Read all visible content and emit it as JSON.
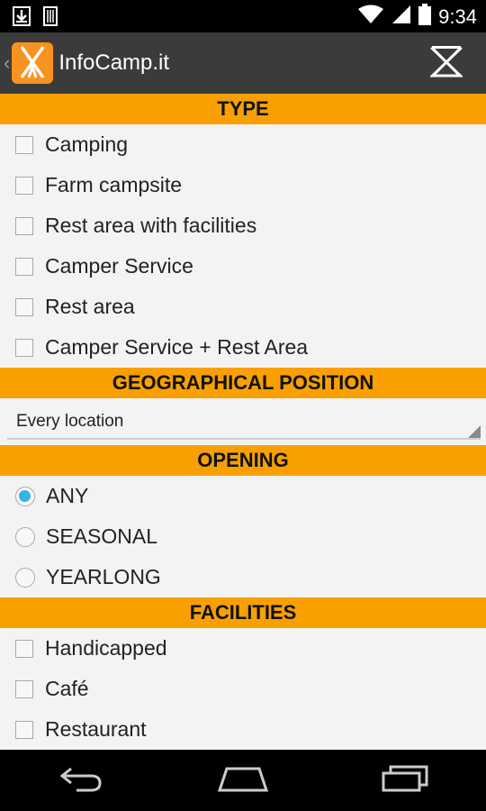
{
  "status_bar": {
    "time": "9:34"
  },
  "app_bar": {
    "title": "InfoCamp.it"
  },
  "sections": {
    "type": {
      "title": "TYPE",
      "items": [
        "Camping",
        "Farm campsite",
        "Rest area with facilities",
        "Camper Service",
        "Rest area",
        "Camper Service + Rest Area"
      ]
    },
    "geo": {
      "title": "GEOGRAPHICAL POSITION",
      "selected": "Every location"
    },
    "opening": {
      "title": "OPENING",
      "options": [
        "ANY",
        "SEASONAL",
        "YEARLONG"
      ],
      "selected": "ANY"
    },
    "facilities": {
      "title": "FACILITIES",
      "items": [
        "Handicapped",
        "Café",
        "Restaurant"
      ]
    }
  },
  "colors": {
    "accent": "#f9a000",
    "radio_selected": "#33b5e5",
    "action_bar": "#3b3b3b"
  },
  "icons": {
    "status_left": [
      "download-icon",
      "sim-card-icon"
    ],
    "status_right": [
      "wifi-icon",
      "signal-icon",
      "battery-icon"
    ],
    "app_logo": "campsite-tent-logo",
    "filter": "filter-off-icon",
    "nav": [
      "back-icon",
      "home-icon",
      "recent-apps-icon"
    ]
  }
}
